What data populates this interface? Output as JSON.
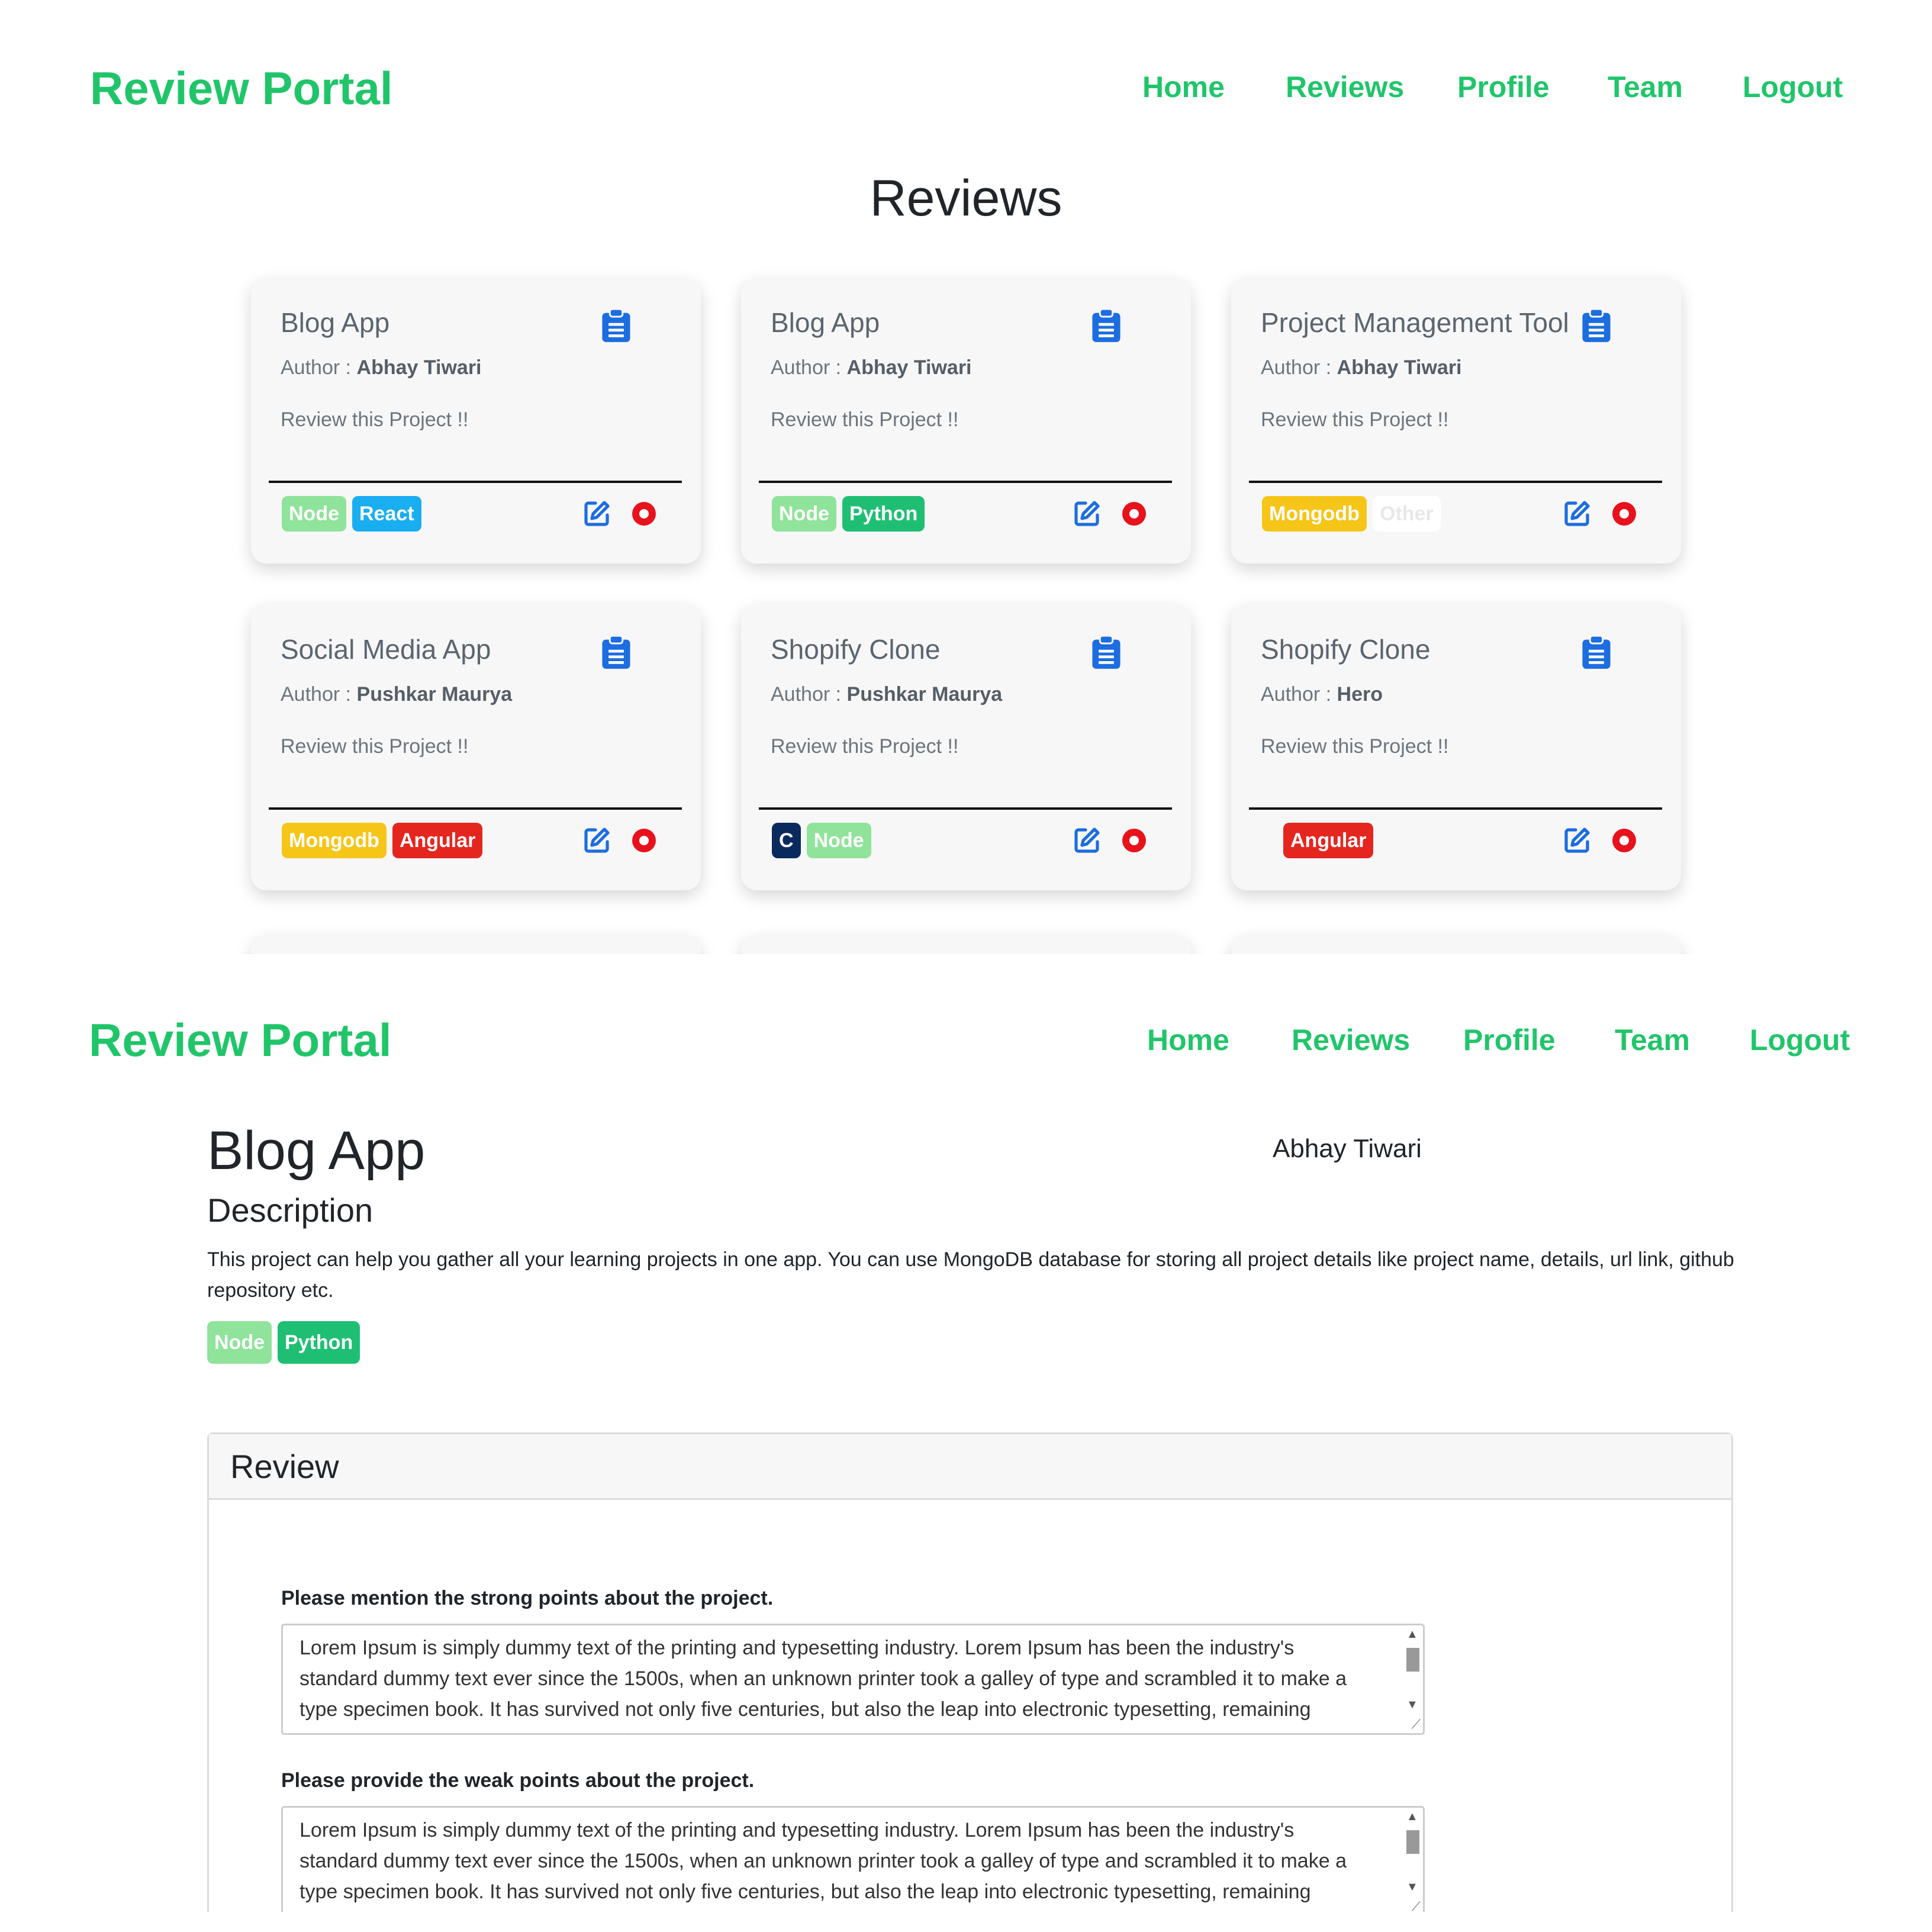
{
  "brand": "Review Portal",
  "nav": [
    "Home",
    "Reviews",
    "Profile",
    "Team",
    "Logout"
  ],
  "reviews_page": {
    "heading": "Reviews",
    "author_prefix": "Author : ",
    "cards": [
      {
        "title": "Blog App",
        "author": "Abhay Tiwari",
        "prompt": "Review this Project !!",
        "tags": [
          {
            "label": "Node",
            "color": "#8fe39a"
          },
          {
            "label": "React",
            "color": "#19aef0"
          }
        ]
      },
      {
        "title": "Blog App",
        "author": "Abhay Tiwari",
        "prompt": "Review this Project !!",
        "tags": [
          {
            "label": "Node",
            "color": "#8fe39a"
          },
          {
            "label": "Python",
            "color": "#1fbf73"
          }
        ]
      },
      {
        "title": "Project Management Tool",
        "author": "Abhay Tiwari",
        "prompt": "Review this Project !!",
        "tags": [
          {
            "label": "Mongodb",
            "color": "#f5c518"
          },
          {
            "label": "Other",
            "color": "#ffffff",
            "text_color": "#e8e8e8"
          }
        ]
      },
      {
        "title": "Social Media App",
        "author": "Pushkar Maurya",
        "prompt": "Review this Project !!",
        "tags": [
          {
            "label": "Mongodb",
            "color": "#f5c518"
          },
          {
            "label": "Angular",
            "color": "#e5261f"
          }
        ]
      },
      {
        "title": "Shopify Clone",
        "author": "Pushkar Maurya",
        "prompt": "Review this Project !!",
        "tags": [
          {
            "label": "C",
            "color": "#0a2a5e"
          },
          {
            "label": "Node",
            "color": "#8fe39a"
          }
        ]
      },
      {
        "title": "Shopify Clone",
        "author": "Hero",
        "prompt": "Review this Project !!",
        "tags": [
          {
            "label": "Angular",
            "color": "#e5261f"
          }
        ]
      }
    ]
  },
  "detail_page": {
    "title": "Blog App",
    "author": "Abhay Tiwari",
    "description_heading": "Description",
    "description": "This project can help you gather all your learning projects in one app. You can use MongoDB database for storing all project details like project name, details, url link, github repository etc.",
    "tags": [
      {
        "label": "Node",
        "color": "#8fe39a"
      },
      {
        "label": "Python",
        "color": "#1fbf73"
      }
    ],
    "review_heading": "Review",
    "questions": [
      {
        "label": "Please mention the strong points about the project.",
        "value": "Lorem Ipsum is simply dummy text of the printing and typesetting industry. Lorem Ipsum has been the industry's standard dummy text ever since the 1500s, when an unknown printer took a galley of type and scrambled it to make a type specimen book. It has survived not only five centuries, but also the leap into electronic typesetting, remaining"
      },
      {
        "label": "Please provide the weak points about the project.",
        "value": "Lorem Ipsum is simply dummy text of the printing and typesetting industry. Lorem Ipsum has been the industry's standard dummy text ever since the 1500s, when an unknown printer took a galley of type and scrambled it to make a type specimen book. It has survived not only five centuries, but also the leap into electronic typesetting, remaining"
      }
    ]
  },
  "colors": {
    "brand_green": "#20c56a",
    "icon_blue": "#1c6de0",
    "stop_red": "#e8121c"
  },
  "icons": {
    "title_icon": "clipboard-icon",
    "edit_icon": "edit-icon",
    "delete_icon": "stop-icon"
  }
}
